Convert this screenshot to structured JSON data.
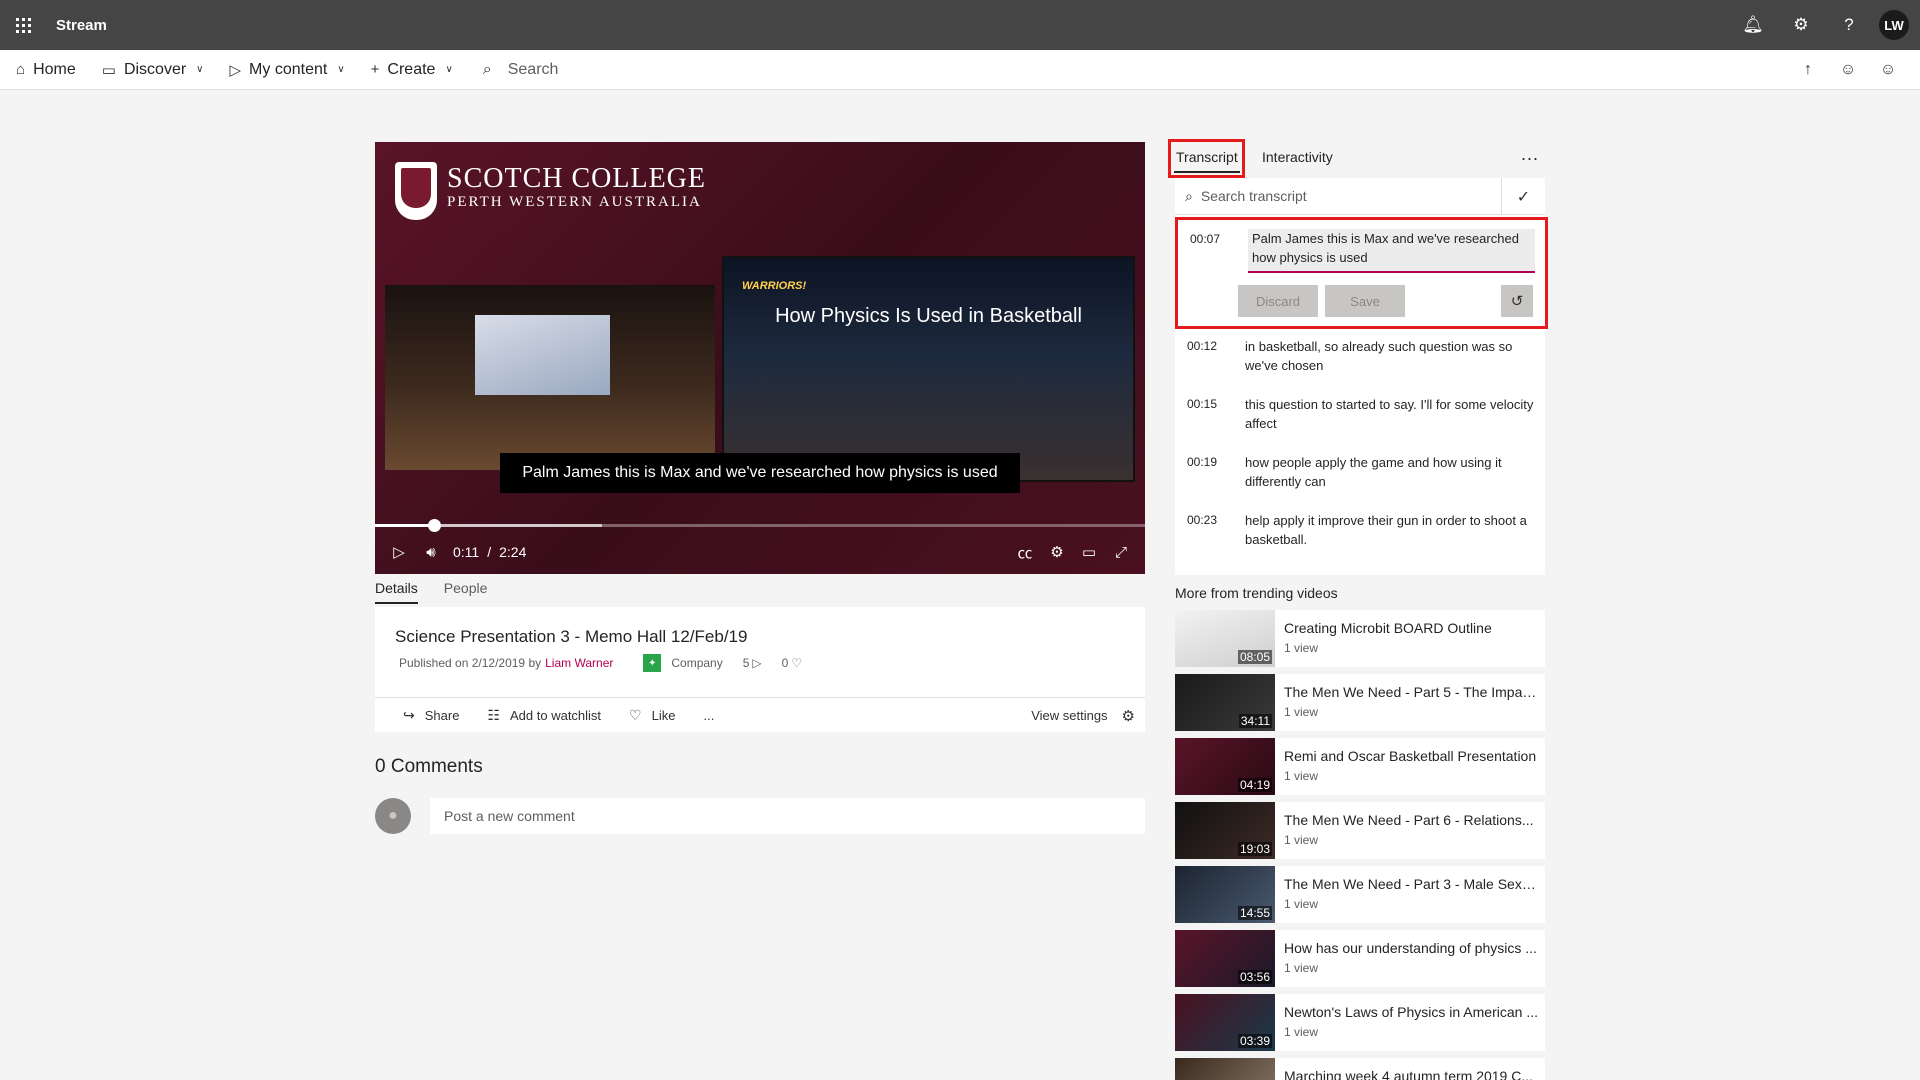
{
  "suite": {
    "app_name": "Stream",
    "user_initials": "LW",
    "icons": [
      "bell-icon",
      "gear-icon",
      "help-icon"
    ]
  },
  "nav": {
    "home": "Home",
    "discover": "Discover",
    "my_content": "My content",
    "create": "Create",
    "search_placeholder": "Search"
  },
  "player": {
    "logo_title": "SCOTCH COLLEGE",
    "logo_subtitle": "PERTH WESTERN AUSTRALIA",
    "inner_title": "How Physics Is Used in Basketball",
    "team_text": "WARRIORS!",
    "caption": "Palm James this is Max and we've researched how physics is used",
    "current_time": "0:11",
    "separator": "/",
    "duration": "2:24",
    "progress_fraction": 0.076,
    "buffer_fraction": 0.295
  },
  "details": {
    "tabs": [
      "Details",
      "People"
    ],
    "title": "Science Presentation 3 - Memo Hall 12/Feb/19",
    "published_prefix": "Published on 2/12/2019 by",
    "author": "Liam Warner",
    "company": "Company",
    "views": "5",
    "likes": "0",
    "actions": {
      "share": "Share",
      "watchlist": "Add to watchlist",
      "like": "Like",
      "more": "...",
      "view_settings": "View settings"
    }
  },
  "comments": {
    "title": "0 Comments",
    "placeholder": "Post a new comment"
  },
  "transcript": {
    "tabs": {
      "transcript": "Transcript",
      "interactivity": "Interactivity",
      "more": "..."
    },
    "search_placeholder": "Search transcript",
    "editing": {
      "time": "00:07",
      "text": "Palm James this is Max and we've researched how physics is used",
      "discard": "Discard",
      "save": "Save"
    },
    "lines": [
      {
        "time": "00:12",
        "text": "in basketball, so already such question was so we've chosen"
      },
      {
        "time": "00:15",
        "text": "this question to started to say. I'll for some velocity affect"
      },
      {
        "time": "00:19",
        "text": "how people apply the game and how using it differently can"
      },
      {
        "time": "00:23",
        "text": "help apply it improve their gun in order to shoot a basketball."
      }
    ]
  },
  "trending": {
    "title": "More from trending videos",
    "items": [
      {
        "name": "Creating Microbit BOARD Outline",
        "views": "1 view",
        "duration": "08:05"
      },
      {
        "name": "The Men We Need - Part 5 - The Impac...",
        "views": "1 view",
        "duration": "34:11"
      },
      {
        "name": "Remi and Oscar Basketball Presentation",
        "views": "1 view",
        "duration": "04:19"
      },
      {
        "name": "The Men We Need - Part 6 - Relations...",
        "views": "1 view",
        "duration": "19:03"
      },
      {
        "name": "The Men We Need - Part 3 - Male Sexu...",
        "views": "1 view",
        "duration": "14:55"
      },
      {
        "name": "How has our understanding of physics ...",
        "views": "1 view",
        "duration": "03:56"
      },
      {
        "name": "Newton's Laws of Physics in American ...",
        "views": "1 view",
        "duration": "03:39"
      },
      {
        "name": "Marching week 4 autumn term 2019 C...",
        "views": "",
        "duration": ""
      }
    ]
  }
}
